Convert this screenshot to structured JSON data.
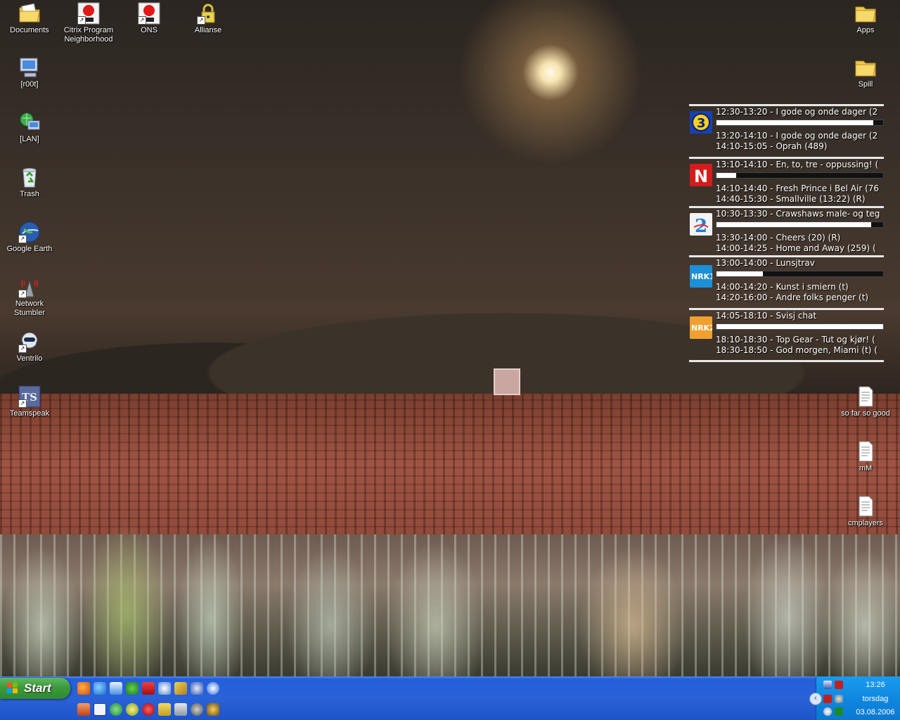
{
  "desktop": {
    "icons_left": [
      {
        "label": "Documents",
        "icon": "folder-documents-icon"
      },
      {
        "label": "Citrix Program Neighborhood",
        "icon": "citrix-icon"
      },
      {
        "label": "ONS",
        "icon": "citrix-icon"
      },
      {
        "label": "Allianse",
        "icon": "lock-icon"
      },
      {
        "label": "[r00t]",
        "icon": "computer-icon"
      },
      {
        "label": "[LAN]",
        "icon": "network-icon"
      },
      {
        "label": "Trash",
        "icon": "recycle-bin-icon"
      },
      {
        "label": "Google Earth",
        "icon": "globe-icon"
      },
      {
        "label": "Network Stumbler",
        "icon": "antenna-icon"
      },
      {
        "label": "Ventrilo",
        "icon": "headset-icon"
      },
      {
        "label": "Teamspeak",
        "icon": "teamspeak-icon"
      }
    ],
    "icons_right": [
      {
        "label": "Apps",
        "icon": "folder-icon"
      },
      {
        "label": "Spill",
        "icon": "folder-icon"
      },
      {
        "label": "so far so good",
        "icon": "text-file-icon"
      },
      {
        "label": "mM",
        "icon": "text-file-icon"
      },
      {
        "label": "cmplayers",
        "icon": "text-file-icon"
      }
    ]
  },
  "tv_guide": {
    "channels": [
      {
        "logo": "tv3-logo",
        "color": "#1a3fb0",
        "now": "12:30-13:20 - I gode og onde dager (2",
        "progress": 0.94,
        "next": [
          "13:20-14:10 - I gode og onde dager (2",
          "14:10-15:05 - Oprah (489)"
        ]
      },
      {
        "logo": "tvnorge-logo",
        "color": "#d41c1c",
        "now": "13:10-14:10 - En, to, tre - oppussing! (",
        "progress": 0.12,
        "next": [
          "14:10-14:40 - Fresh Prince i Bel Air (76",
          "14:40-15:30 - Smallville (13:22) (R)"
        ]
      },
      {
        "logo": "tv2-logo",
        "color": "#f2f2f2",
        "now": "10:30-13:30 - Crawshaws male- og teg",
        "progress": 0.93,
        "next": [
          "13:30-14:00 - Cheers (20) (R)",
          "14:00-14:25 - Home and Away (259) ("
        ]
      },
      {
        "logo": "nrk1-logo",
        "color": "#1c8fd6",
        "now": "13:00-14:00 - Lunsjtrav",
        "progress": 0.28,
        "next": [
          "14:00-14:20 - Kunst i smiern (t)",
          "14:20-16:00 - Andre folks penger (t)"
        ]
      },
      {
        "logo": "nrk2-logo",
        "color": "#f0a030",
        "now": "14:05-18:10 - Svisj chat",
        "progress": 1.0,
        "next": [
          "18:10-18:30 - Top Gear - Tut og kjør! (",
          "18:30-18:50 - God morgen, Miami (t) ("
        ]
      }
    ]
  },
  "taskbar": {
    "start_label": "Start",
    "quicklaunch_row1": [
      "firefox-icon",
      "ie-icon",
      "outlook-icon",
      "msn-icon",
      "citrix-icon",
      "aim-icon",
      "pencil-icon",
      "network-icon",
      "media-player-icon"
    ],
    "quicklaunch_row2": [
      "winrar-icon",
      "editor-icon",
      "refresh-icon",
      "msn-butterfly-icon",
      "opera-icon",
      "folder-search-icon",
      "network-drive-icon",
      "search-icon",
      "winamp-icon"
    ],
    "tray_icons": [
      "display-icon",
      "citrix-tray-icon",
      "network-tray-icon",
      "users-tray-icon",
      "wifi-icon",
      "battery-icon"
    ],
    "clock_time": "13:26",
    "clock_day": "torsdag",
    "clock_date": "03.08.2006"
  }
}
